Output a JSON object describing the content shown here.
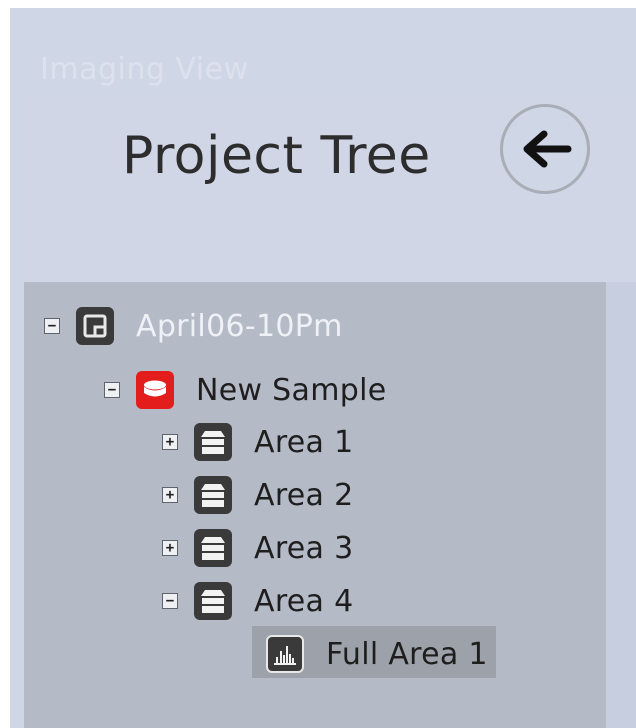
{
  "window": {
    "title": "Imaging View"
  },
  "header": {
    "title": "Project Tree",
    "back_icon": "arrow-left-icon"
  },
  "tree": {
    "root": {
      "label": "April06-10Pm",
      "toggle": "−",
      "icon": "project-icon"
    },
    "sample": {
      "label": "New Sample",
      "toggle": "−",
      "icon": "sample-icon",
      "icon_color": "#e31c1c"
    },
    "areas": [
      {
        "label": "Area 1",
        "toggle": "+",
        "icon": "area-icon"
      },
      {
        "label": "Area 2",
        "toggle": "+",
        "icon": "area-icon"
      },
      {
        "label": "Area 3",
        "toggle": "+",
        "icon": "area-icon"
      },
      {
        "label": "Area 4",
        "toggle": "−",
        "icon": "area-icon"
      }
    ],
    "scan": {
      "label": "Full Area 1",
      "icon": "spectrum-icon",
      "selected": true
    }
  }
}
